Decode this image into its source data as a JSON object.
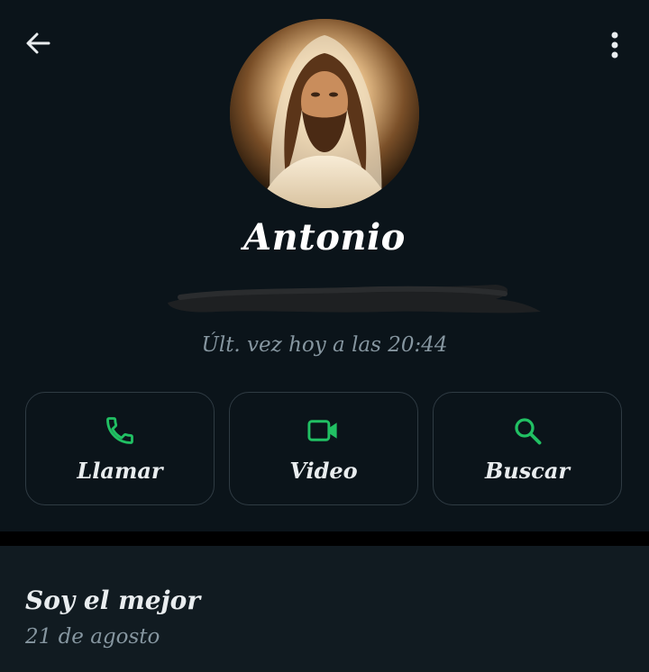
{
  "header": {
    "back_icon": "arrow-left-icon",
    "menu_icon": "more-vertical-icon"
  },
  "contact": {
    "name": "Antonio",
    "last_seen": "Últ. vez hoy a las 20:44"
  },
  "actions": [
    {
      "label": "Llamar",
      "icon": "phone-icon"
    },
    {
      "label": "Video",
      "icon": "video-icon"
    },
    {
      "label": "Buscar",
      "icon": "search-icon"
    }
  ],
  "about": {
    "text": "Soy el mejor",
    "date": "21 de agosto"
  },
  "colors": {
    "background": "#0b141a",
    "accent": "#21c063",
    "muted": "#8696a0",
    "card_border": "#2f3b43"
  }
}
